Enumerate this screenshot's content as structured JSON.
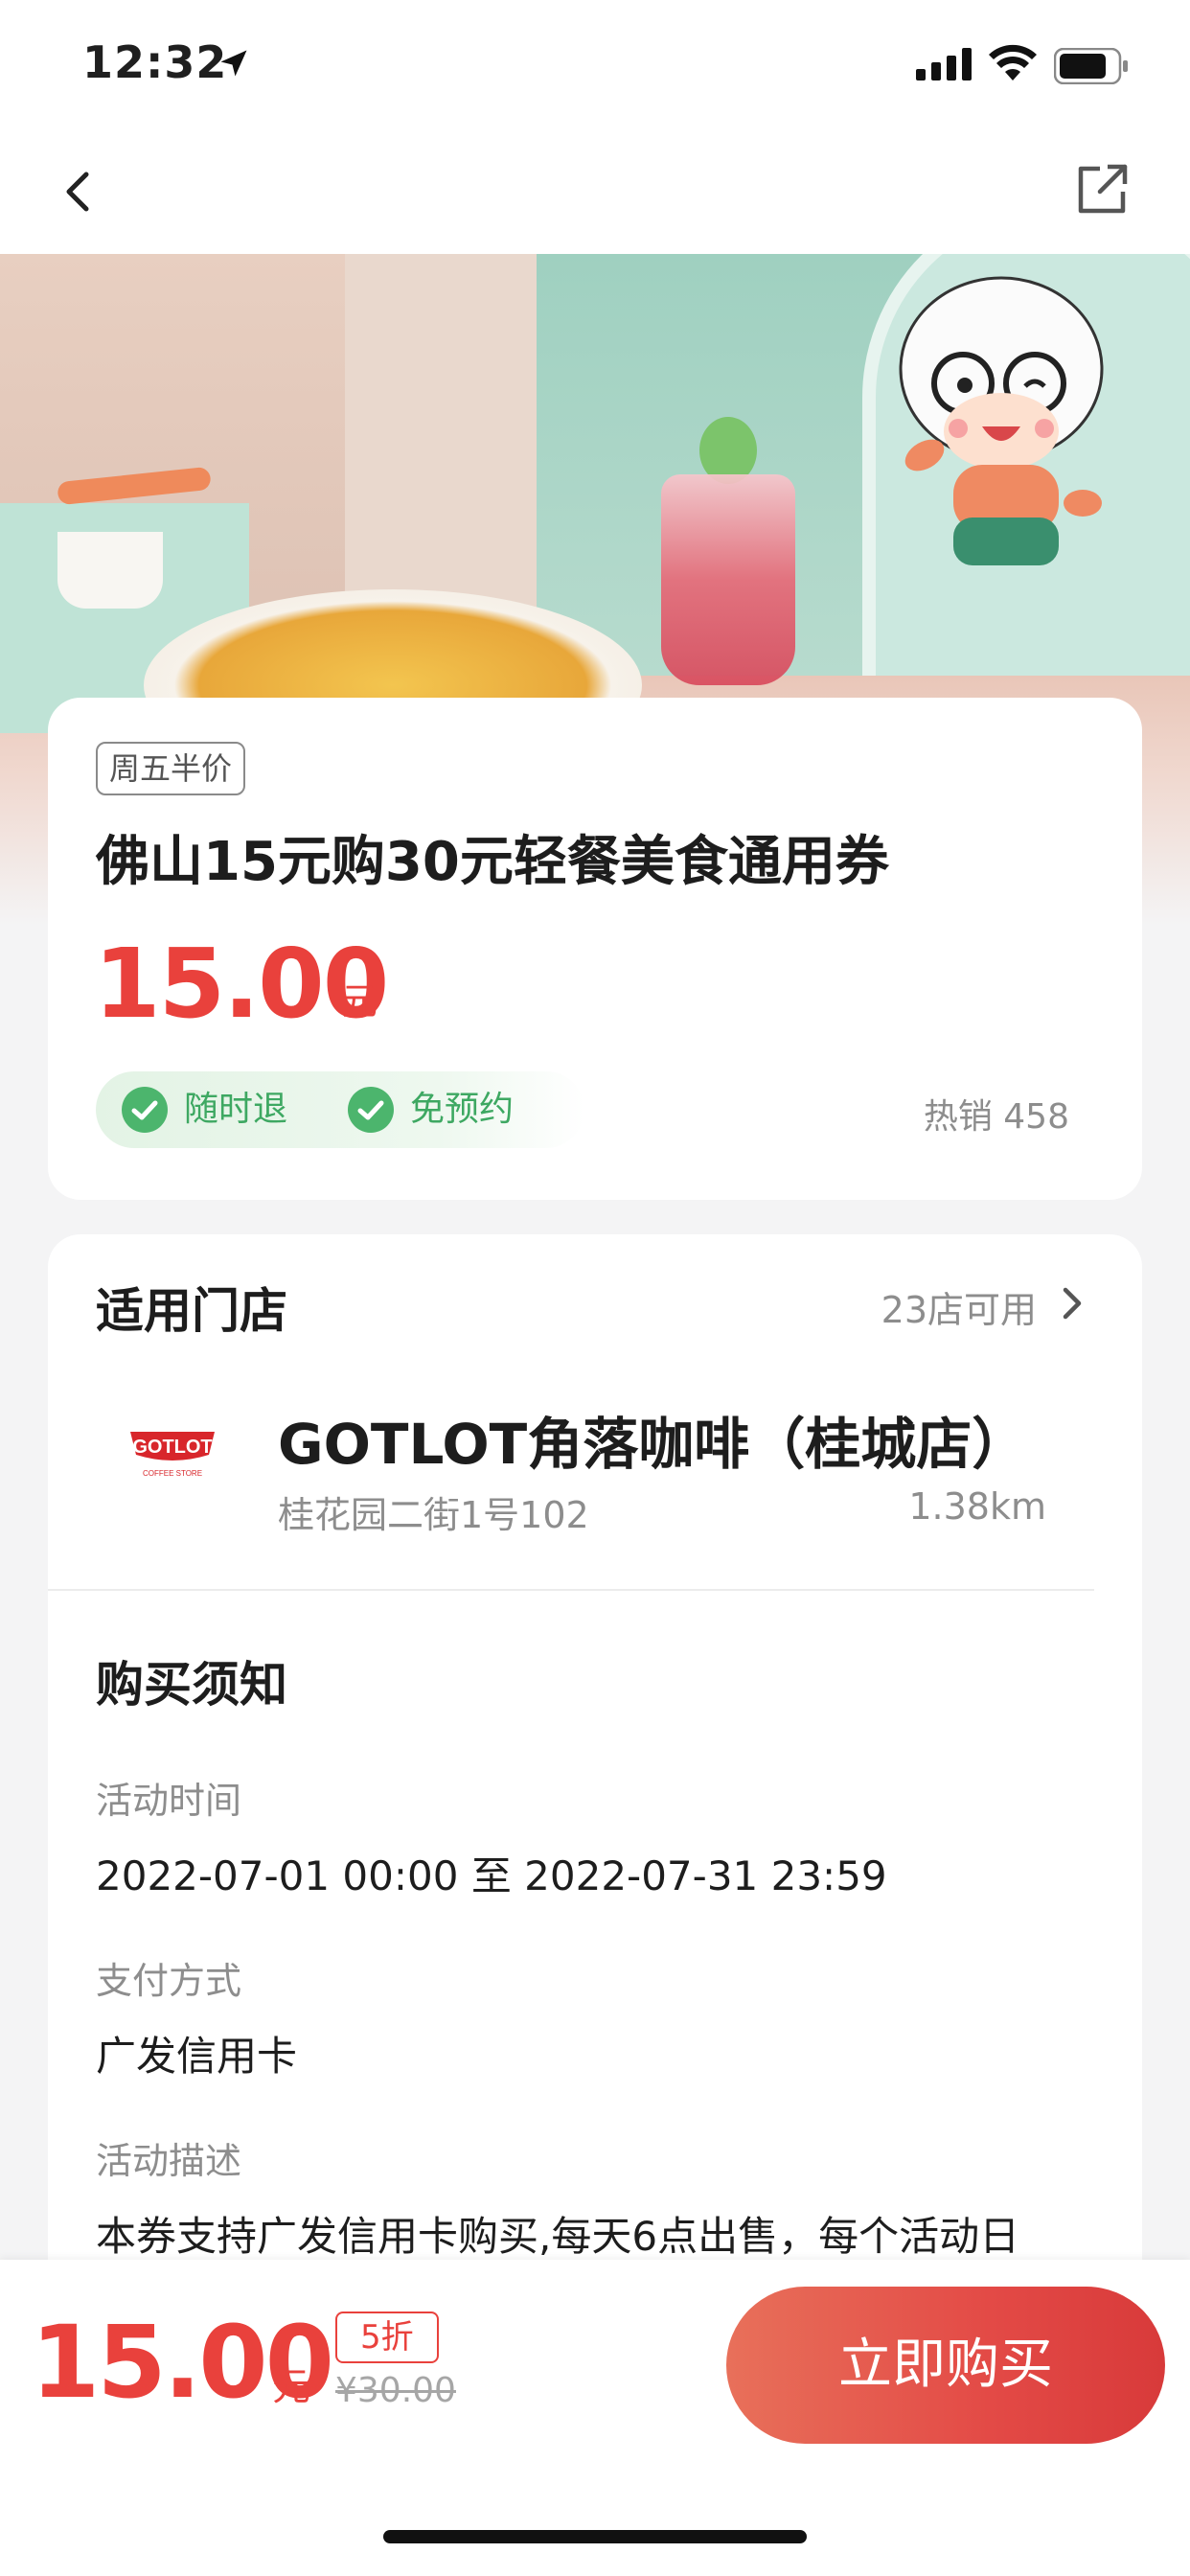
{
  "status_bar": {
    "time": "12:32"
  },
  "hero": {
    "image_desc_icon": "food-photo-with-mascot"
  },
  "deal": {
    "tag": "周五半价",
    "title": "佛山15元购30元轻餐美食通用券",
    "price": "15.00",
    "price_unit": "元",
    "perks": [
      "随时退",
      "免预约"
    ],
    "hot_sales": "热销 458"
  },
  "stores": {
    "title": "适用门店",
    "count": "23店可用",
    "store_name": "GOTLOT角落咖啡（桂城店）",
    "address": "桂花园二街1号102",
    "distance": "1.38km",
    "logo_text": "GOTLOT",
    "logo_sub": "COFFEE STORE"
  },
  "notice": {
    "title": "购买须知",
    "items": [
      {
        "label": "活动时间",
        "value": "2022-07-01 00:00 至 2022-07-31 23:59"
      },
      {
        "label": "支付方式",
        "value": "广发信用卡"
      },
      {
        "label": "活动描述",
        "value": "本券支持广发信用卡购买,每天6点出售，每个活动日"
      }
    ]
  },
  "bottom_bar": {
    "price": "15.00",
    "unit": "元",
    "discount": "5折",
    "original_price": "¥30.00",
    "buy_label": "立即购买"
  },
  "colors": {
    "accent": "#e9413c",
    "success": "#3ea862"
  }
}
